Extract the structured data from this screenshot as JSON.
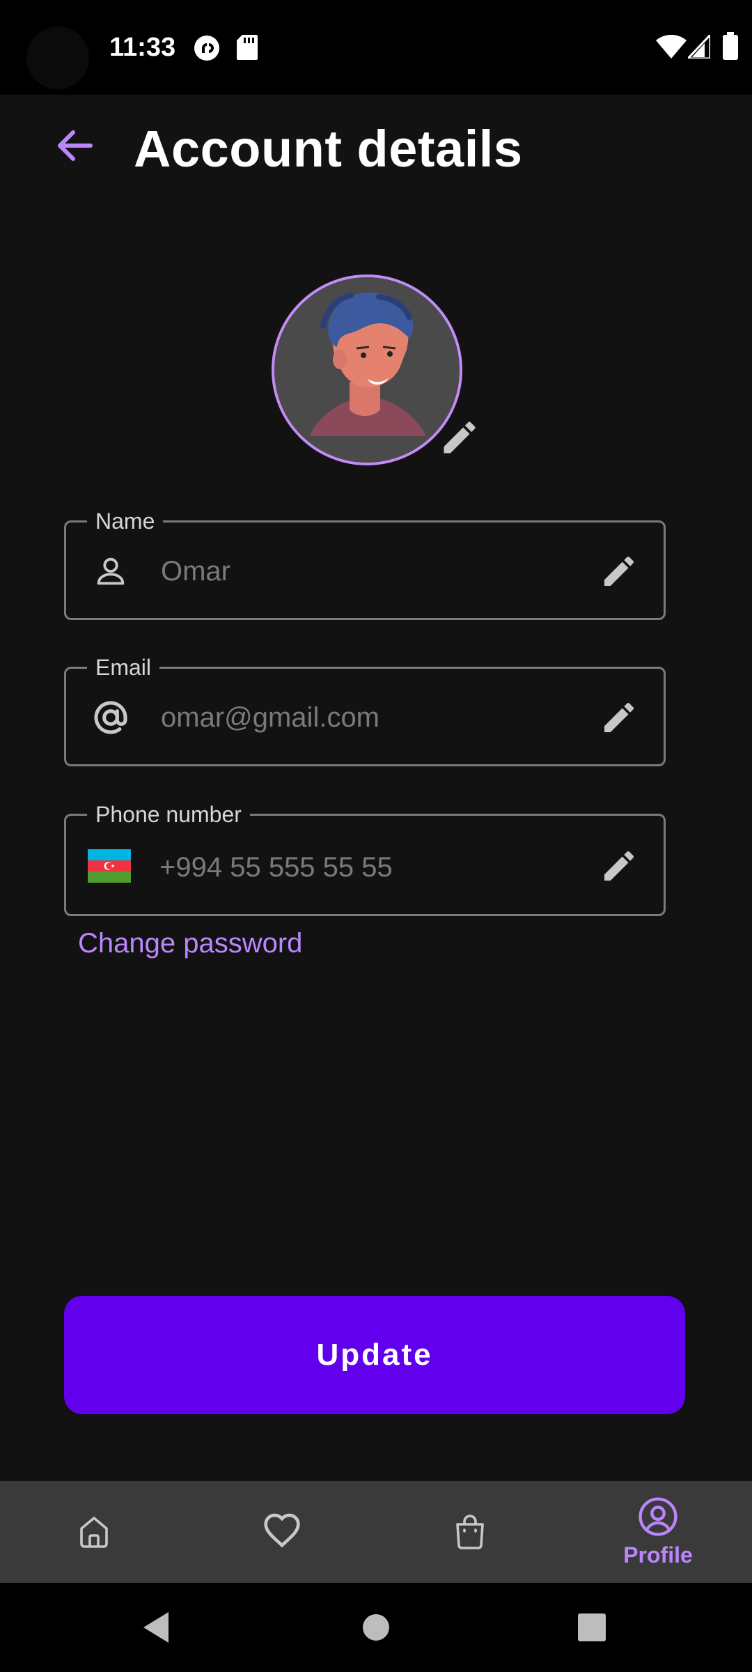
{
  "status_bar": {
    "time": "11:33",
    "icons_left": [
      "pocket-casts-icon",
      "sd-card-icon"
    ],
    "icons_right": [
      "wifi-icon",
      "cell-signal-icon",
      "battery-icon"
    ]
  },
  "header": {
    "title": "Account details",
    "back_icon": "arrow-left-icon"
  },
  "avatar": {
    "edit_icon": "pencil-icon"
  },
  "form": {
    "name": {
      "label": "Name",
      "icon": "person-outline-icon",
      "placeholder": "Omar",
      "value": ""
    },
    "email": {
      "label": "Email",
      "icon": "at-sign-icon",
      "placeholder": "omar@gmail.com",
      "value": ""
    },
    "phone": {
      "label": "Phone number",
      "icon": "azerbaijan-flag-icon",
      "placeholder": "+994 55 555 55 55",
      "value": ""
    }
  },
  "change_password": "Change password",
  "update_button": "Update",
  "bottom_nav": {
    "items": [
      {
        "id": "home",
        "icon": "home-icon",
        "label": ""
      },
      {
        "id": "favorites",
        "icon": "heart-icon",
        "label": ""
      },
      {
        "id": "cart",
        "icon": "shopping-bag-icon",
        "label": ""
      },
      {
        "id": "profile",
        "icon": "profile-icon",
        "label": "Profile",
        "active": true
      }
    ]
  },
  "colors": {
    "background": "#121212",
    "accent": "#bb86fc",
    "primary_button": "#6200ee",
    "nav_background": "#3a3a3a",
    "field_border": "#7b7b7b"
  }
}
